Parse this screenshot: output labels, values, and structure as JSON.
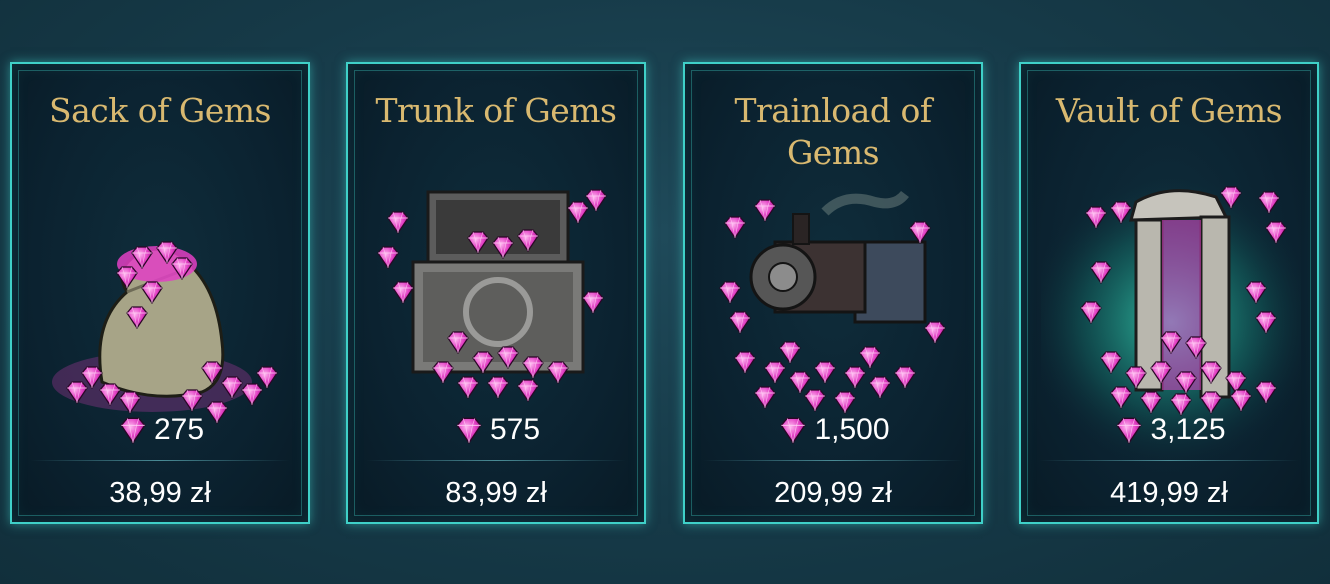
{
  "offers": [
    {
      "title": "Sack of Gems",
      "amount": "275",
      "price": "38,99 zł",
      "icon": "gem-sack-icon"
    },
    {
      "title": "Trunk of Gems",
      "amount": "575",
      "price": "83,99 zł",
      "icon": "gem-trunk-icon"
    },
    {
      "title": "Trainload of Gems",
      "amount": "1,500",
      "price": "209,99 zł",
      "icon": "gem-train-icon"
    },
    {
      "title": "Vault of Gems",
      "amount": "3,125",
      "price": "419,99 zł",
      "icon": "gem-vault-icon"
    }
  ],
  "colors": {
    "accent": "#3fd0c8",
    "title": "#d9b970",
    "gem": "#e23fc4"
  }
}
